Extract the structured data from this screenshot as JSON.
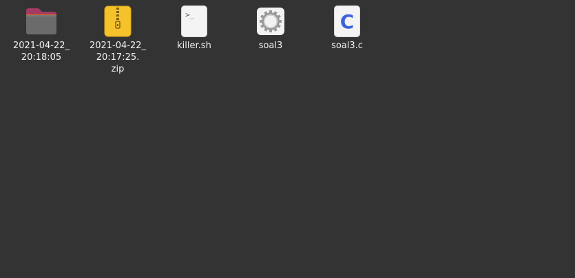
{
  "desktop": {
    "items": [
      {
        "kind": "folder",
        "icon": "folder-icon",
        "label_lines": [
          "2021-04-22_",
          "20:18:05"
        ]
      },
      {
        "kind": "archive",
        "icon": "zip-archive-icon",
        "label_lines": [
          "2021-04-22_",
          "20:17:25.",
          "zip"
        ]
      },
      {
        "kind": "shell-script",
        "icon": "terminal-script-icon",
        "label_lines": [
          "killer.sh"
        ],
        "glyph": ">_"
      },
      {
        "kind": "executable",
        "icon": "gear-executable-icon",
        "label_lines": [
          "soal3"
        ]
      },
      {
        "kind": "c-source",
        "icon": "c-source-icon",
        "label_lines": [
          "soal3.c"
        ],
        "glyph": "C"
      }
    ]
  },
  "colors": {
    "background": "#333333",
    "text": "#f2f2f2",
    "folder_tab": "#a23b63",
    "folder_body": "#6b6b6b",
    "zip": "#f5c22c",
    "c_letter": "#3d63dd"
  }
}
